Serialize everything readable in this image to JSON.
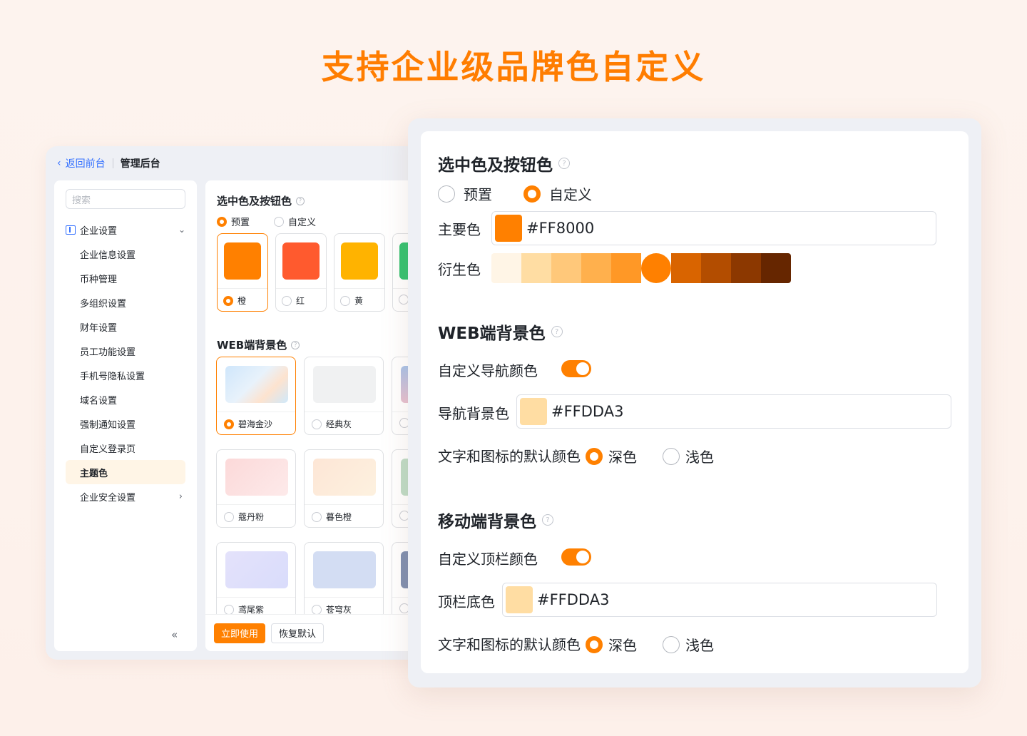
{
  "hero": {
    "title": "支持企业级品牌色自定义"
  },
  "admin": {
    "back_label": "返回前台",
    "title": "管理后台",
    "search_placeholder": "搜索",
    "nav_group": "企业设置",
    "nav_items": [
      "企业信息设置",
      "币种管理",
      "多组织设置",
      "财年设置",
      "员工功能设置",
      "手机号隐私设置",
      "域名设置",
      "强制通知设置",
      "自定义登录页",
      "主题色"
    ],
    "nav_security": "企业安全设置",
    "collapse_glyph": "«",
    "section_color_title": "选中色及按钮色",
    "radio_preset": "预置",
    "radio_custom": "自定义",
    "swatches": [
      {
        "label": "橙",
        "color": "#ff8000"
      },
      {
        "label": "红",
        "color": "#ff5a2e"
      },
      {
        "label": "黄",
        "color": "#ffb300"
      },
      {
        "label": "",
        "color": "#34c270"
      }
    ],
    "section_web_title": "WEB端背景色",
    "bg_cards": [
      {
        "label": "碧海金沙"
      },
      {
        "label": "经典灰"
      },
      {
        "label": ""
      },
      {
        "label": "蔻丹粉"
      },
      {
        "label": "暮色橙"
      },
      {
        "label": ""
      },
      {
        "label": "鸢尾紫"
      },
      {
        "label": "苍穹灰"
      },
      {
        "label": ""
      }
    ],
    "btn_apply": "立即使用",
    "btn_reset": "恢复默认"
  },
  "settings": {
    "section1_title": "选中色及按钮色",
    "radio_preset": "预置",
    "radio_custom": "自定义",
    "main_color_label": "主要色",
    "main_color_value": "#FF8000",
    "derived_label": "衍生色",
    "derived_colors": [
      "#fff5e6",
      "#ffdda3",
      "#ffc87a",
      "#ffb04d",
      "#ff9826",
      "#ff8000",
      "#d96400",
      "#b34d00",
      "#8c3800",
      "#662600"
    ],
    "section2_title": "WEB端背景色",
    "web_nav_toggle_label": "自定义导航颜色",
    "web_nav_bg_label": "导航背景色",
    "web_nav_bg_value": "#FFDDA3",
    "web_text_color_label": "文字和图标的默认颜色",
    "dark_label": "深色",
    "light_label": "浅色",
    "section3_title": "移动端背景色",
    "mobile_toggle_label": "自定义顶栏颜色",
    "mobile_bg_label": "顶栏底色",
    "mobile_bg_value": "#FFDDA3",
    "mobile_text_color_label": "文字和图标的默认颜色"
  }
}
